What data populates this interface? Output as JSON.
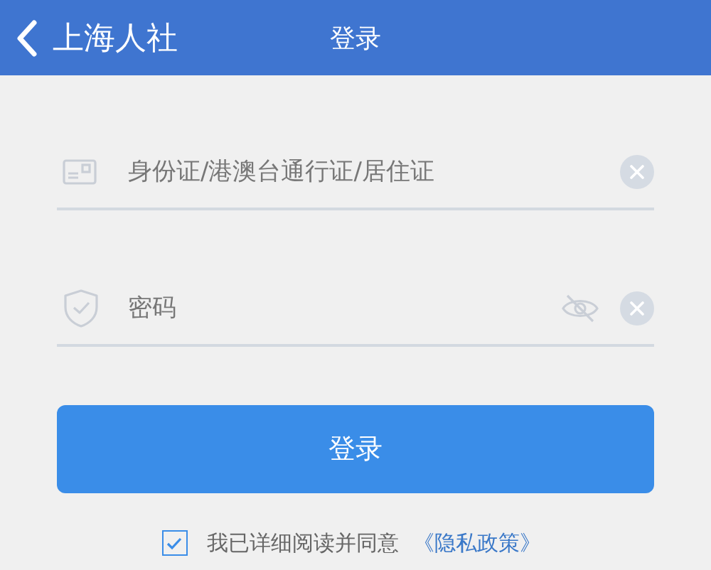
{
  "header": {
    "back_label": "上海人社",
    "title": "登录"
  },
  "fields": [
    {
      "kind": "id",
      "placeholder": "身份证/港澳台通行证/居住证"
    },
    {
      "kind": "password",
      "placeholder": "密码",
      "revealed": false
    }
  ],
  "login_button": "登录",
  "agreement": {
    "checked": true,
    "text": "我已详细阅读并同意",
    "link": "《隐私政策》"
  }
}
